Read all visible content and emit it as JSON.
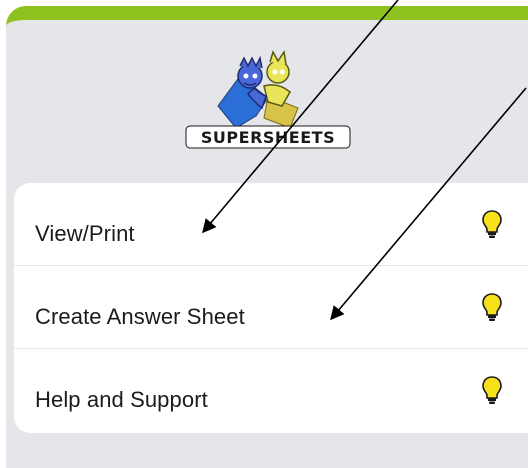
{
  "header": {
    "accent_color": "#8dc21f",
    "panel_color": "#e5e6ea",
    "logo_text": "SUPERSHEETS"
  },
  "menu": {
    "items": [
      {
        "label": "View/Print",
        "icon": "lightbulb-icon"
      },
      {
        "label": "Create Answer Sheet",
        "icon": "lightbulb-icon"
      },
      {
        "label": "Help and Support",
        "icon": "lightbulb-icon"
      }
    ]
  },
  "colors": {
    "bulb_fill": "#f7e11c",
    "bulb_stroke": "#1a1a1a",
    "arrow": "#000000"
  }
}
